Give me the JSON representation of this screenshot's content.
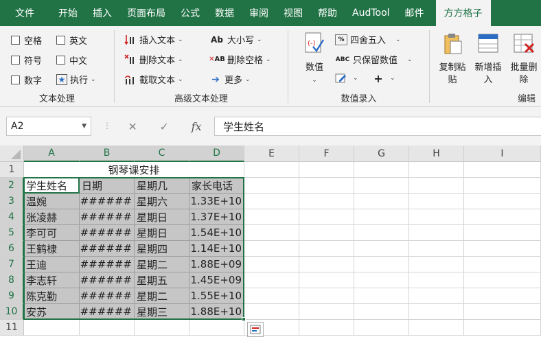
{
  "menu": {
    "tabs": [
      "文件",
      "开始",
      "插入",
      "页面布局",
      "公式",
      "数据",
      "审阅",
      "视图",
      "帮助",
      "AudTool",
      "邮件"
    ],
    "active_tab": "方方格子"
  },
  "ribbon": {
    "text_group": {
      "label": "文本处理",
      "space": "空格",
      "english": "英文",
      "symbol": "符号",
      "chinese": "中文",
      "number": "数字",
      "execute": "执行"
    },
    "advanced_group": {
      "label": "高级文本处理",
      "insert_text": "插入文本",
      "delete_text": "删除文本",
      "extract_text": "截取文本",
      "case": "大小写",
      "case_icon_text": "Ab",
      "delete_space": "删除空格",
      "delete_space_icon_text": "AB",
      "more": "更多"
    },
    "numeric_group": {
      "label": "数值录入",
      "value": "数值",
      "round": "四舍五入",
      "keep_value": "只保留数值",
      "keep_value_icon_text": "ABC"
    },
    "edit_group": {
      "label": "编辑",
      "copy_paste": "复制粘贴",
      "insert_new": "新增插入",
      "batch_delete": "批量删除"
    }
  },
  "formula_bar": {
    "name_box": "A2",
    "cancel": "✕",
    "confirm": "✓",
    "fx": "fx",
    "content": "学生姓名"
  },
  "sheet": {
    "columns": [
      "A",
      "B",
      "C",
      "D",
      "E",
      "F",
      "G",
      "H",
      "I"
    ],
    "rows": [
      "1",
      "2",
      "3",
      "4",
      "5",
      "6",
      "7",
      "8",
      "9",
      "10",
      "11"
    ],
    "title": "钢琴课安排",
    "headers": [
      "学生姓名",
      "日期",
      "星期几",
      "家长电话"
    ],
    "data": [
      [
        "温婉",
        "######",
        "星期六",
        "1.33E+10"
      ],
      [
        "张凌赫",
        "######",
        "星期日",
        "1.37E+10"
      ],
      [
        "李可可",
        "######",
        "星期日",
        "1.54E+10"
      ],
      [
        "王鹤棣",
        "######",
        "星期四",
        "1.14E+10"
      ],
      [
        "王迪",
        "######",
        "星期二",
        "1.88E+09"
      ],
      [
        "李志轩",
        "######",
        "星期五",
        "1.45E+09"
      ],
      [
        "陈克勤",
        "######",
        "星期二",
        "1.55E+10"
      ],
      [
        "安苏",
        "######",
        "星期三",
        "1.88E+10"
      ]
    ]
  },
  "colors": {
    "accent": "#217346",
    "selection": "#c6c6c6"
  }
}
